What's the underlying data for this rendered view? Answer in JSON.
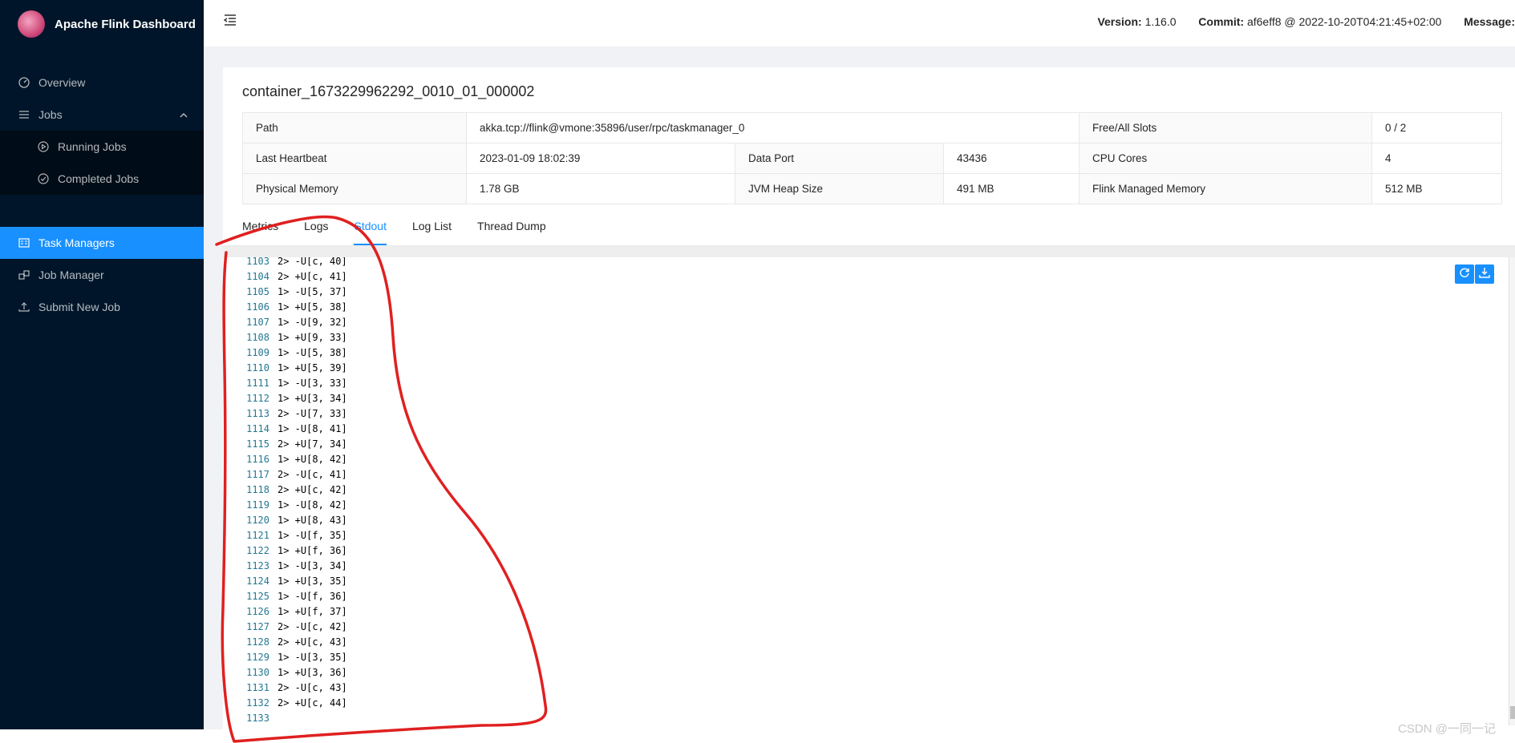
{
  "app": {
    "title": "Apache Flink Dashboard"
  },
  "sidebar": {
    "items": [
      {
        "label": "Overview"
      },
      {
        "label": "Jobs"
      },
      {
        "label": "Running Jobs"
      },
      {
        "label": "Completed Jobs"
      },
      {
        "label": "Task Managers"
      },
      {
        "label": "Job Manager"
      },
      {
        "label": "Submit New Job"
      }
    ]
  },
  "header": {
    "version_label": "Version:",
    "version_value": "1.16.0",
    "commit_label": "Commit:",
    "commit_value": "af6eff8 @ 2022-10-20T04:21:45+02:00",
    "message_label": "Message:"
  },
  "taskmanager": {
    "id": "container_1673229962292_0010_01_000002",
    "path_label": "Path",
    "path_value": "akka.tcp://flink@vmone:35896/user/rpc/taskmanager_0",
    "slots_label": "Free/All Slots",
    "slots_value": "0 / 2",
    "heartbeat_label": "Last Heartbeat",
    "heartbeat_value": "2023-01-09 18:02:39",
    "dataport_label": "Data Port",
    "dataport_value": "43436",
    "cpu_label": "CPU Cores",
    "cpu_value": "4",
    "memory_label": "Physical Memory",
    "memory_value": "1.78 GB",
    "heap_label": "JVM Heap Size",
    "heap_value": "491 MB",
    "managed_label": "Flink Managed Memory",
    "managed_value": "512 MB"
  },
  "tabs": [
    {
      "label": "Metrics"
    },
    {
      "label": "Logs"
    },
    {
      "label": "Stdout"
    },
    {
      "label": "Log List"
    },
    {
      "label": "Thread Dump"
    }
  ],
  "active_tab": "Stdout",
  "stdout": {
    "lines": [
      {
        "n": "1103",
        "t": "2> -U[c, 40]"
      },
      {
        "n": "1104",
        "t": "2> +U[c, 41]"
      },
      {
        "n": "1105",
        "t": "1> -U[5, 37]"
      },
      {
        "n": "1106",
        "t": "1> +U[5, 38]"
      },
      {
        "n": "1107",
        "t": "1> -U[9, 32]"
      },
      {
        "n": "1108",
        "t": "1> +U[9, 33]"
      },
      {
        "n": "1109",
        "t": "1> -U[5, 38]"
      },
      {
        "n": "1110",
        "t": "1> +U[5, 39]"
      },
      {
        "n": "1111",
        "t": "1> -U[3, 33]"
      },
      {
        "n": "1112",
        "t": "1> +U[3, 34]"
      },
      {
        "n": "1113",
        "t": "2> -U[7, 33]"
      },
      {
        "n": "1114",
        "t": "1> -U[8, 41]"
      },
      {
        "n": "1115",
        "t": "2> +U[7, 34]"
      },
      {
        "n": "1116",
        "t": "1> +U[8, 42]"
      },
      {
        "n": "1117",
        "t": "2> -U[c, 41]"
      },
      {
        "n": "1118",
        "t": "2> +U[c, 42]"
      },
      {
        "n": "1119",
        "t": "1> -U[8, 42]"
      },
      {
        "n": "1120",
        "t": "1> +U[8, 43]"
      },
      {
        "n": "1121",
        "t": "1> -U[f, 35]"
      },
      {
        "n": "1122",
        "t": "1> +U[f, 36]"
      },
      {
        "n": "1123",
        "t": "1> -U[3, 34]"
      },
      {
        "n": "1124",
        "t": "1> +U[3, 35]"
      },
      {
        "n": "1125",
        "t": "1> -U[f, 36]"
      },
      {
        "n": "1126",
        "t": "1> +U[f, 37]"
      },
      {
        "n": "1127",
        "t": "2> -U[c, 42]"
      },
      {
        "n": "1128",
        "t": "2> +U[c, 43]"
      },
      {
        "n": "1129",
        "t": "1> -U[3, 35]"
      },
      {
        "n": "1130",
        "t": "1> +U[3, 36]"
      },
      {
        "n": "1131",
        "t": "2> -U[c, 43]"
      },
      {
        "n": "1132",
        "t": "2> +U[c, 44]"
      },
      {
        "n": "1133",
        "t": ""
      }
    ]
  },
  "watermark": "CSDN @一同一记",
  "colors": {
    "sidebar_bg": "#001529",
    "accent": "#1890ff",
    "annotation": "#e02020"
  },
  "icons": [
    "menu-fold-icon",
    "dashboard-icon",
    "list-icon",
    "play-circle-icon",
    "check-circle-icon",
    "task-manager-icon",
    "cluster-icon",
    "upload-icon",
    "reload-icon",
    "download-icon"
  ]
}
